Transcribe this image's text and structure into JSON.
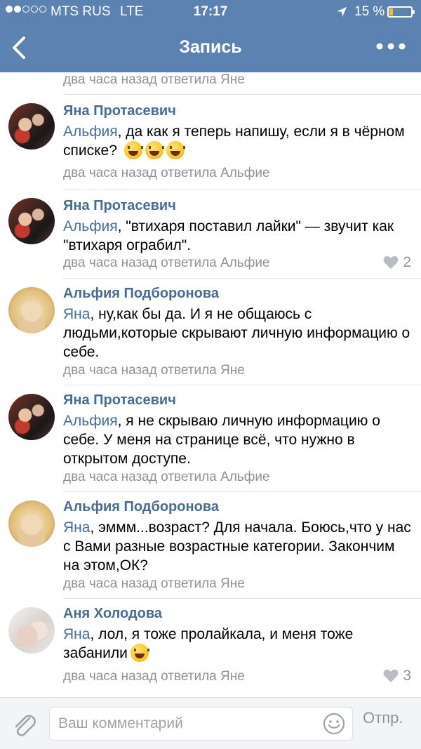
{
  "status_bar": {
    "carrier": "MTS RUS",
    "network": "LTE",
    "time": "17:17",
    "battery_percent": "15 %",
    "signal_bars_filled": 2,
    "signal_bars_total": 5
  },
  "nav": {
    "title": "Запись"
  },
  "previous_comment_meta": "два часа назад ответила Яне",
  "comments": [
    {
      "author": "Яна Протасевич",
      "mention": "Альфия",
      "text": ", да как я теперь напишу, если я в чёрном списке? ",
      "emojis": 3,
      "meta": "два часа назад ответила Альфие",
      "likes": ""
    },
    {
      "author": "Яна Протасевич",
      "mention": "Альфия",
      "text": ", \"втихаря поставил лайки\" — звучит как \"втихаря ограбил\".",
      "emojis": 0,
      "meta": "два часа назад ответила Альфие",
      "likes": "2"
    },
    {
      "author": "Альфия Подборонова",
      "mention": "Яна",
      "text": ", ну,как бы да. И я не общаюсь с людьми,которые скрывают личную информацию о себе.",
      "emojis": 0,
      "meta": "два часа назад ответила Яне",
      "likes": ""
    },
    {
      "author": "Яна Протасевич",
      "mention": "Альфия",
      "text": ", я не скрываю личную информацию о себе. У меня на странице всё, что нужно в открытом доступе.",
      "emojis": 0,
      "meta": "два часа назад ответила Альфие",
      "likes": ""
    },
    {
      "author": "Альфия Подборонова",
      "mention": "Яна",
      "text": ", эммм...возраст? Для начала. Боюсь,что у нас с Вами разные возрастные категории. Закончим на этом,ОК?",
      "emojis": 0,
      "meta": "два часа назад ответила Яне",
      "likes": ""
    },
    {
      "author": "Аня Холодова",
      "mention": "Яна",
      "text": ", лол, я тоже пролайкала, и меня тоже забанили",
      "emojis": 1,
      "meta": "два часа назад ответила Яне",
      "likes": "3"
    }
  ],
  "input": {
    "placeholder": "Ваш комментарий",
    "value": "",
    "send_label": "Отпр."
  },
  "colors": {
    "header": "#5b82b0",
    "link": "#466d99",
    "meta": "#8f9399",
    "battery_low": "#f0c21a"
  },
  "icons": {
    "back": "chevron-left-icon",
    "more": "more-dots-icon",
    "location": "location-arrow-icon",
    "like": "heart-icon",
    "attach": "paperclip-icon",
    "emoji": "smiley-icon"
  }
}
